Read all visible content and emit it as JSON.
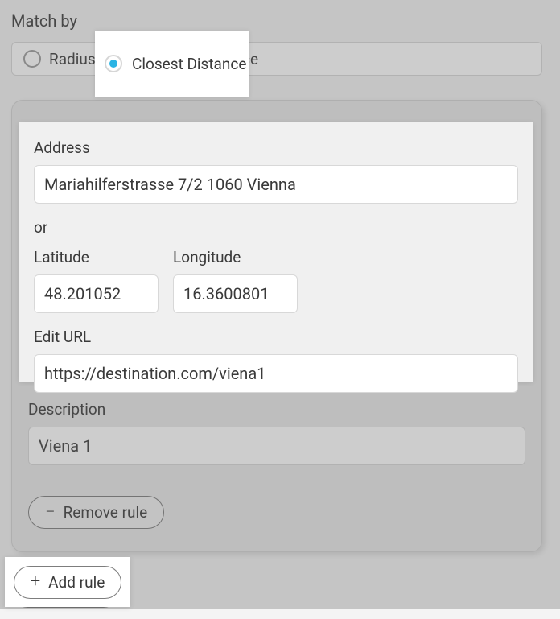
{
  "matchBy": {
    "title": "Match by",
    "options": {
      "radius": "Radius",
      "closest": "Closest Distance"
    }
  },
  "rule": {
    "address": {
      "label": "Address",
      "value": "Mariahilferstrasse 7/2 1060 Vienna"
    },
    "or": "or",
    "latitude": {
      "label": "Latitude",
      "value": "48.201052"
    },
    "longitude": {
      "label": "Longitude",
      "value": "16.3600801"
    },
    "editUrl": {
      "label": "Edit URL",
      "value": "https://destination.com/viena1"
    },
    "description": {
      "label": "Description",
      "value": "Viena 1"
    },
    "removeLabel": "Remove rule"
  },
  "addRuleLabel": "Add rule"
}
